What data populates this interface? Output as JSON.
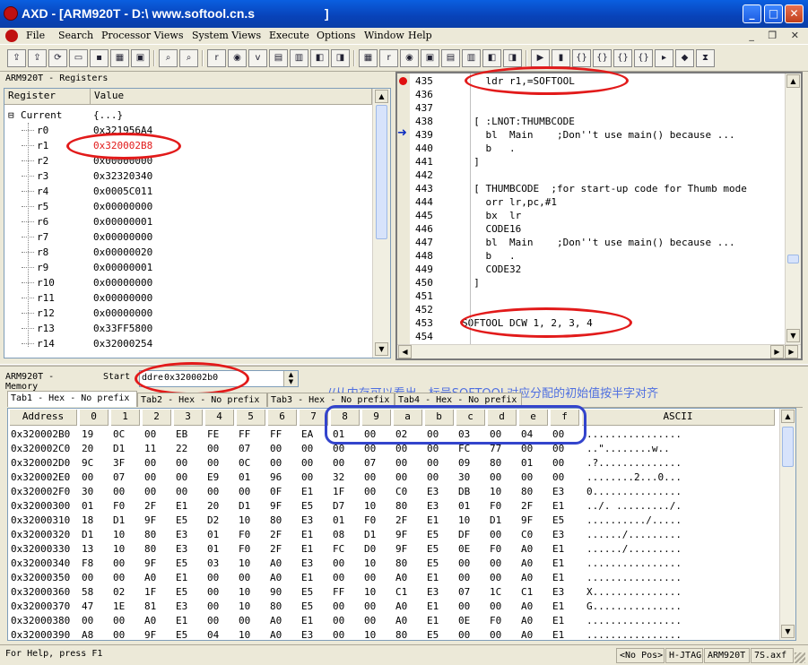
{
  "window": {
    "title": "AXD - [ARM920T - D:\\ www.softool.cn.s                    ]",
    "minimize": "_",
    "maximize": "□",
    "close": "✕",
    "mdi_buttons": "_ ❐ ✕"
  },
  "menu": [
    "File",
    "Search",
    "Processor Views",
    "System Views",
    "Execute",
    "Options",
    "Window",
    "Help"
  ],
  "toolbar_icons": [
    "load-image-icon",
    "reload-icon",
    "refresh-icon",
    "open-folder-icon",
    "save-icon",
    "debug-windows-icon",
    "window-icon",
    "binoculars-icon",
    "binoculars-next-icon",
    "registers-icon",
    "search-icon",
    "variables-icon",
    "memory-icon",
    "disasm-icon",
    "breakpoints-icon",
    "watch-icon",
    "view1-icon",
    "view2-icon",
    "view3-icon",
    "view4-icon",
    "view5-icon",
    "view6-icon",
    "view7-icon",
    "view8-icon",
    "go-icon",
    "stop-icon",
    "step-in-icon",
    "step-over-icon",
    "step-out-icon",
    "run-to-cursor-icon",
    "set-pc-icon",
    "toggle-bp-icon",
    "hourglass-icon"
  ],
  "registers": {
    "title": "ARM920T - Registers",
    "col_register": "Register",
    "col_value": "Value",
    "group": "Current",
    "group_value": "{...}",
    "rows": [
      {
        "name": "r0",
        "value": "0x321956A4"
      },
      {
        "name": "r1",
        "value": "0x320002B8"
      },
      {
        "name": "r2",
        "value": "0x00000000"
      },
      {
        "name": "r3",
        "value": "0x32320340"
      },
      {
        "name": "r4",
        "value": "0x0005C011"
      },
      {
        "name": "r5",
        "value": "0x00000000"
      },
      {
        "name": "r6",
        "value": "0x00000001"
      },
      {
        "name": "r7",
        "value": "0x00000000"
      },
      {
        "name": "r8",
        "value": "0x00000020"
      },
      {
        "name": "r9",
        "value": "0x00000001"
      },
      {
        "name": "r10",
        "value": "0x00000000"
      },
      {
        "name": "r11",
        "value": "0x00000000"
      },
      {
        "name": "r12",
        "value": "0x00000000"
      },
      {
        "name": "r13",
        "value": "0x33FF5800"
      },
      {
        "name": "r14",
        "value": "0x32000254"
      }
    ]
  },
  "source": {
    "lines": [
      {
        "num": "435",
        "text": "    ldr r1,=SOFTOOL",
        "marker": "breakpoint"
      },
      {
        "num": "436",
        "text": "",
        "marker": ""
      },
      {
        "num": "437",
        "text": "",
        "marker": ""
      },
      {
        "num": "438",
        "text": "  [ :LNOT:THUMBCODE",
        "marker": ""
      },
      {
        "num": "439",
        "text": "    bl  Main    ;Don''t use main() because ...",
        "marker": "pc"
      },
      {
        "num": "440",
        "text": "    b   .",
        "marker": ""
      },
      {
        "num": "441",
        "text": "  ]",
        "marker": ""
      },
      {
        "num": "442",
        "text": "",
        "marker": ""
      },
      {
        "num": "443",
        "text": "  [ THUMBCODE  ;for start-up code for Thumb mode",
        "marker": ""
      },
      {
        "num": "444",
        "text": "    orr lr,pc,#1",
        "marker": ""
      },
      {
        "num": "445",
        "text": "    bx  lr",
        "marker": ""
      },
      {
        "num": "446",
        "text": "    CODE16",
        "marker": ""
      },
      {
        "num": "447",
        "text": "    bl  Main    ;Don''t use main() because ...",
        "marker": ""
      },
      {
        "num": "448",
        "text": "    b   .",
        "marker": ""
      },
      {
        "num": "449",
        "text": "    CODE32",
        "marker": ""
      },
      {
        "num": "450",
        "text": "  ]",
        "marker": ""
      },
      {
        "num": "451",
        "text": "",
        "marker": ""
      },
      {
        "num": "452",
        "text": "",
        "marker": ""
      },
      {
        "num": "453",
        "text": "SOFTOOL DCW 1, 2, 3, 4",
        "marker": ""
      },
      {
        "num": "454",
        "text": "",
        "marker": ""
      }
    ]
  },
  "memory": {
    "title": "ARM920T - Memory",
    "start_label": "Start",
    "address_label": "ddre",
    "start_address": "0x320002b0",
    "annotation": "//从内存可以看出，标号SOFTOOL对应分配的初始值按半字对齐",
    "tabs": [
      "Tab1 - Hex - No prefix",
      "Tab2 - Hex - No prefix",
      "Tab3 - Hex - No prefix",
      "Tab4 - Hex - No prefix"
    ],
    "columns": [
      "Address",
      "0",
      "1",
      "2",
      "3",
      "4",
      "5",
      "6",
      "7",
      "8",
      "9",
      "a",
      "b",
      "c",
      "d",
      "e",
      "f",
      "ASCII"
    ],
    "rows": [
      {
        "addr": "0x320002B0",
        "bytes": [
          "19",
          "0C",
          "00",
          "EB",
          "FE",
          "FF",
          "FF",
          "EA",
          "01",
          "00",
          "02",
          "00",
          "03",
          "00",
          "04",
          "00"
        ],
        "ascii": "................"
      },
      {
        "addr": "0x320002C0",
        "bytes": [
          "20",
          "D1",
          "11",
          "22",
          "00",
          "07",
          "00",
          "00",
          "00",
          "00",
          "00",
          "00",
          "FC",
          "77",
          "00",
          "00"
        ],
        "ascii": "..\"........w.."
      },
      {
        "addr": "0x320002D0",
        "bytes": [
          "9C",
          "3F",
          "00",
          "00",
          "00",
          "0C",
          "00",
          "00",
          "00",
          "07",
          "00",
          "00",
          "09",
          "80",
          "01",
          "00"
        ],
        "ascii": ".?.............."
      },
      {
        "addr": "0x320002E0",
        "bytes": [
          "00",
          "07",
          "00",
          "00",
          "E9",
          "01",
          "96",
          "00",
          "32",
          "00",
          "00",
          "00",
          "30",
          "00",
          "00",
          "00"
        ],
        "ascii": "........2...0..."
      },
      {
        "addr": "0x320002F0",
        "bytes": [
          "30",
          "00",
          "00",
          "00",
          "00",
          "00",
          "0F",
          "E1",
          "1F",
          "00",
          "C0",
          "E3",
          "DB",
          "10",
          "80",
          "E3"
        ],
        "ascii": "0..............."
      },
      {
        "addr": "0x32000300",
        "bytes": [
          "01",
          "F0",
          "2F",
          "E1",
          "20",
          "D1",
          "9F",
          "E5",
          "D7",
          "10",
          "80",
          "E3",
          "01",
          "F0",
          "2F",
          "E1"
        ],
        "ascii": "../. ........./."
      },
      {
        "addr": "0x32000310",
        "bytes": [
          "18",
          "D1",
          "9F",
          "E5",
          "D2",
          "10",
          "80",
          "E3",
          "01",
          "F0",
          "2F",
          "E1",
          "10",
          "D1",
          "9F",
          "E5"
        ],
        "ascii": "........../....."
      },
      {
        "addr": "0x32000320",
        "bytes": [
          "D1",
          "10",
          "80",
          "E3",
          "01",
          "F0",
          "2F",
          "E1",
          "08",
          "D1",
          "9F",
          "E5",
          "DF",
          "00",
          "C0",
          "E3"
        ],
        "ascii": "....../........."
      },
      {
        "addr": "0x32000330",
        "bytes": [
          "13",
          "10",
          "80",
          "E3",
          "01",
          "F0",
          "2F",
          "E1",
          "FC",
          "D0",
          "9F",
          "E5",
          "0E",
          "F0",
          "A0",
          "E1"
        ],
        "ascii": "....../........."
      },
      {
        "addr": "0x32000340",
        "bytes": [
          "F8",
          "00",
          "9F",
          "E5",
          "03",
          "10",
          "A0",
          "E3",
          "00",
          "10",
          "80",
          "E5",
          "00",
          "00",
          "A0",
          "E1"
        ],
        "ascii": "................"
      },
      {
        "addr": "0x32000350",
        "bytes": [
          "00",
          "00",
          "A0",
          "E1",
          "00",
          "00",
          "A0",
          "E1",
          "00",
          "00",
          "A0",
          "E1",
          "00",
          "00",
          "A0",
          "E1"
        ],
        "ascii": "................"
      },
      {
        "addr": "0x32000360",
        "bytes": [
          "58",
          "02",
          "1F",
          "E5",
          "00",
          "10",
          "90",
          "E5",
          "FF",
          "10",
          "C1",
          "E3",
          "07",
          "1C",
          "C1",
          "E3"
        ],
        "ascii": "X..............."
      },
      {
        "addr": "0x32000370",
        "bytes": [
          "47",
          "1E",
          "81",
          "E3",
          "00",
          "10",
          "80",
          "E5",
          "00",
          "00",
          "A0",
          "E1",
          "00",
          "00",
          "A0",
          "E1"
        ],
        "ascii": "G..............."
      },
      {
        "addr": "0x32000380",
        "bytes": [
          "00",
          "00",
          "A0",
          "E1",
          "00",
          "00",
          "A0",
          "E1",
          "00",
          "00",
          "A0",
          "E1",
          "0E",
          "F0",
          "A0",
          "E1"
        ],
        "ascii": "................"
      },
      {
        "addr": "0x32000390",
        "bytes": [
          "A8",
          "00",
          "9F",
          "E5",
          "04",
          "10",
          "A0",
          "E3",
          "00",
          "10",
          "80",
          "E5",
          "00",
          "00",
          "A0",
          "E1"
        ],
        "ascii": "................"
      }
    ]
  },
  "status": {
    "help": "For Help, press F1",
    "pos": "<No Pos>",
    "target": "H-JTAG",
    "cpu": "ARM920T",
    "image": "7S.axf"
  },
  "colors": {
    "annotation_red": "#e21a1a",
    "annotation_blue": "#3344cc",
    "highlight_value": "#e21a1a",
    "annotation_text": "#4f6fe0"
  }
}
